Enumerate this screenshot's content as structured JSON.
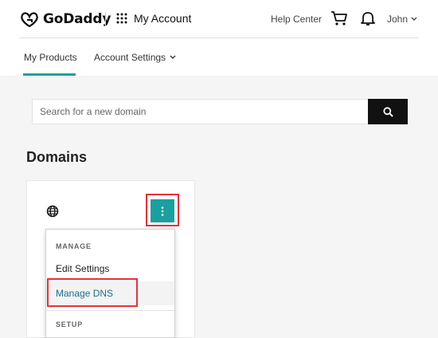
{
  "header": {
    "brand": "GoDaddy",
    "account_title": "My Account",
    "help_link": "Help Center",
    "user_name": "John"
  },
  "nav": {
    "tabs": [
      {
        "label": "My Products",
        "active": true
      },
      {
        "label": "Account Settings",
        "active": false
      }
    ]
  },
  "search": {
    "placeholder": "Search for a new domain",
    "value": ""
  },
  "domains": {
    "title": "Domains"
  },
  "menu": {
    "manage_heading": "MANAGE",
    "items": [
      {
        "label": "Edit Settings"
      },
      {
        "label": "Manage DNS"
      }
    ],
    "setup_heading": "SETUP"
  },
  "colors": {
    "accent_teal": "#1aa0a0",
    "highlight_red": "#e8303a",
    "search_button": "#111111"
  },
  "icons": [
    "godaddy-logo-icon",
    "apps-grid-icon",
    "cart-icon",
    "bell-icon",
    "chevron-down-icon",
    "search-icon",
    "globe-icon",
    "kebab-menu-icon"
  ]
}
